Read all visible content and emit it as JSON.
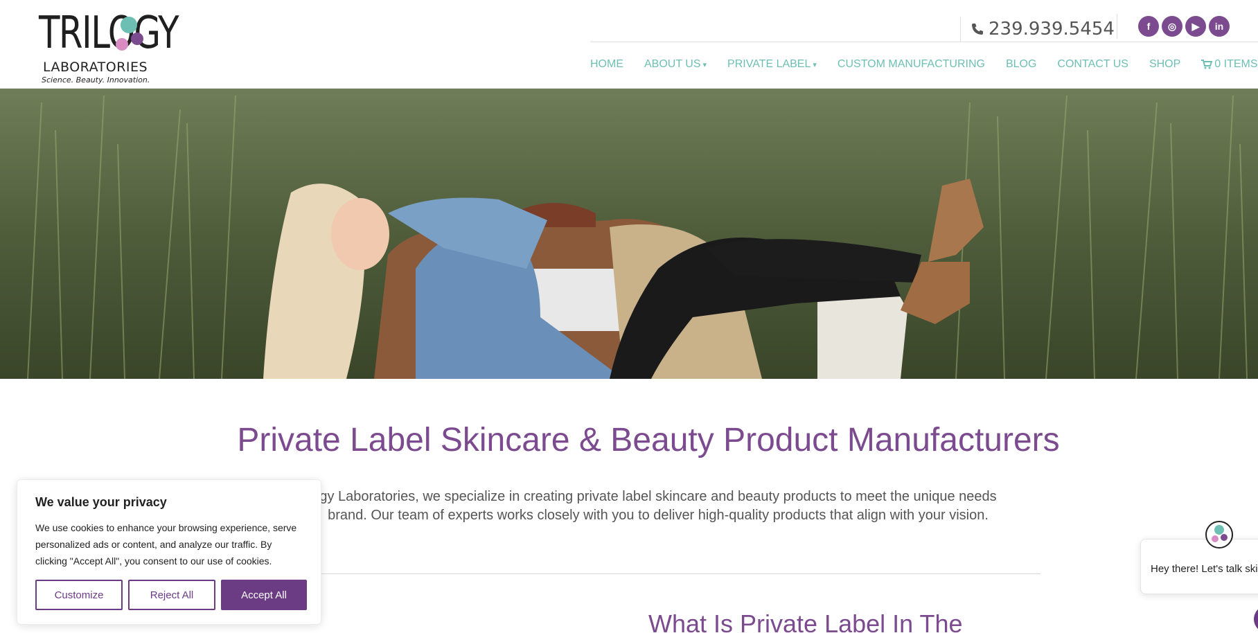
{
  "brand": {
    "logo_word": "TRILOGY",
    "logo_sub": "LABORATORIES",
    "logo_tagline": "Science. Beauty. Innovation.",
    "colors": {
      "purple": "#7b4a8f",
      "teal": "#6dbfb3",
      "pink": "#d98bc4"
    }
  },
  "header": {
    "phone": "239.939.5454",
    "social": [
      {
        "name": "facebook-icon",
        "glyph": "f"
      },
      {
        "name": "location-pin-icon",
        "glyph": "◎"
      },
      {
        "name": "youtube-icon",
        "glyph": "▶"
      },
      {
        "name": "linkedin-icon",
        "glyph": "in"
      }
    ],
    "nav": [
      {
        "label": "HOME",
        "dropdown": false
      },
      {
        "label": "ABOUT US",
        "dropdown": true
      },
      {
        "label": "PRIVATE LABEL",
        "dropdown": true
      },
      {
        "label": "CUSTOM MANUFACTURING",
        "dropdown": false
      },
      {
        "label": "BLOG",
        "dropdown": false
      },
      {
        "label": "CONTACT US",
        "dropdown": false
      },
      {
        "label": "SHOP",
        "dropdown": false
      }
    ],
    "cart_label": "0 ITEMS"
  },
  "main": {
    "title": "Private Label Skincare & Beauty Product Manufacturers",
    "intro_line1": "gy Laboratories, we specialize in creating private label skincare and beauty products to meet the unique needs",
    "intro_line2": "brand. Our team of experts works closely with you to deliver high-quality products that align with your vision.",
    "subheading": "What Is Private Label In The"
  },
  "cookie": {
    "title": "We value your privacy",
    "text": "We use cookies to enhance your browsing experience, serve personalized ads or content, and analyze our traffic. By clicking \"Accept All\", you consent to our use of cookies.",
    "customize": "Customize",
    "reject": "Reject All",
    "accept": "Accept All"
  },
  "chat": {
    "greeting": "Hey there! Let's talk ski"
  }
}
